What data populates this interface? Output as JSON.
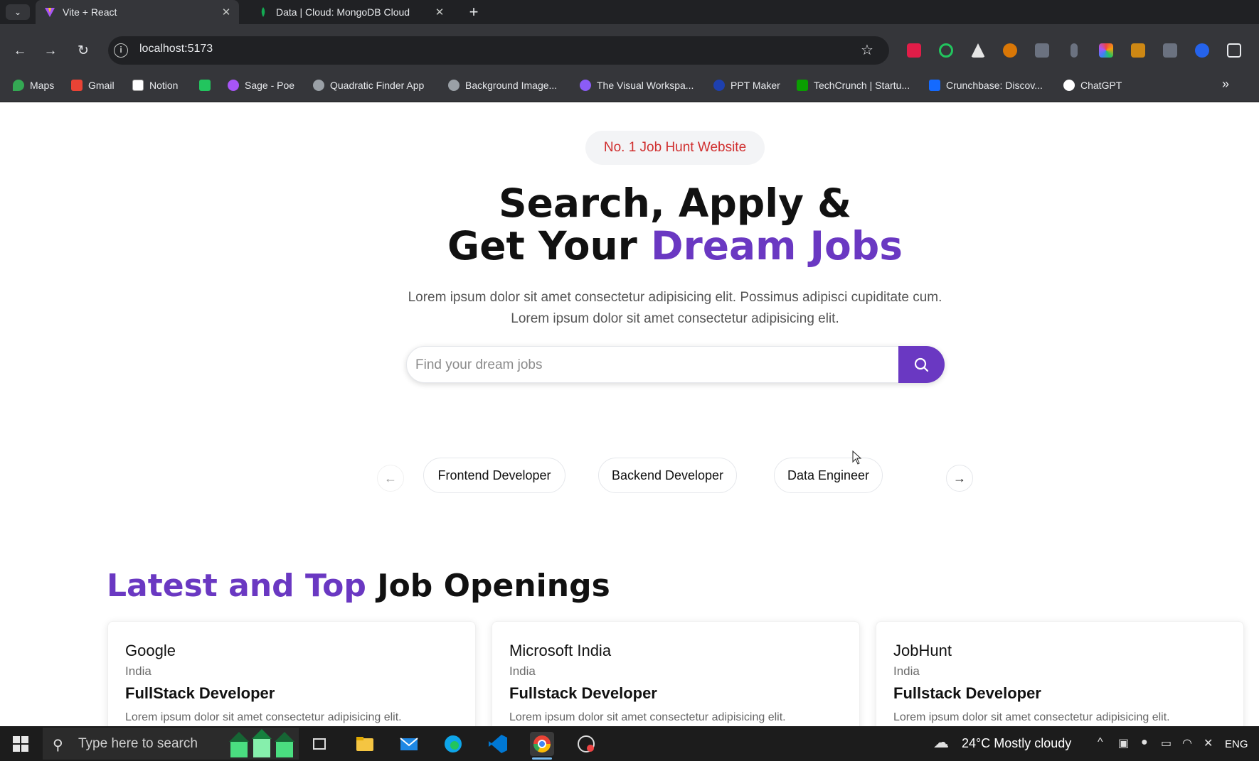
{
  "browser": {
    "tabs": [
      {
        "title": "Vite + React",
        "active": true,
        "icon": "vite-icon"
      },
      {
        "title": "Data | Cloud: MongoDB Cloud",
        "active": false,
        "icon": "mongodb-leaf-icon"
      }
    ],
    "close_glyph": "✕",
    "new_tab_glyph": "+",
    "url": "localhost:5173",
    "bookmarks": [
      {
        "label": "Maps",
        "icon": "maps-icon",
        "color": "#34a853"
      },
      {
        "label": "Gmail",
        "icon": "gmail-icon",
        "color": "#ea4335"
      },
      {
        "label": "Notion",
        "icon": "notion-icon",
        "color": "#ffffff"
      },
      {
        "label": "",
        "icon": "sheet-icon",
        "color": "#22c55e"
      },
      {
        "label": "Sage - Poe",
        "icon": "poe-icon",
        "color": "#a855f7"
      },
      {
        "label": "Quadratic Finder App",
        "icon": "globe-icon",
        "color": "#9aa0a6"
      },
      {
        "label": "Background Image...",
        "icon": "globe-icon",
        "color": "#9aa0a6"
      },
      {
        "label": "The Visual Workspa...",
        "icon": "workspace-icon",
        "color": "#8b5cf6"
      },
      {
        "label": "PPT Maker",
        "icon": "ppt-maker-icon",
        "color": "#1e40af"
      },
      {
        "label": "TechCrunch | Startu...",
        "icon": "techcrunch-icon",
        "color": "#0a9e01"
      },
      {
        "label": "Crunchbase: Discov...",
        "icon": "crunchbase-icon",
        "color": "#146aff"
      },
      {
        "label": "ChatGPT",
        "icon": "chatgpt-icon",
        "color": "#ffffff"
      }
    ]
  },
  "hero": {
    "badge": "No. 1 Job Hunt Website",
    "title_line1": "Search, Apply &",
    "title_line2_plain": "Get Your ",
    "title_line2_accent": "Dream Jobs",
    "subtitle_line1": "Lorem ipsum dolor sit amet consectetur adipisicing elit. Possimus adipisci cupiditate cum.",
    "subtitle_line2": "Lorem ipsum dolor sit amet consectetur adipisicing elit.",
    "search_placeholder": "Find your dream jobs"
  },
  "categories": {
    "prev_glyph": "←",
    "next_glyph": "→",
    "items": [
      "Frontend Developer",
      "Backend Developer",
      "Data Engineer"
    ]
  },
  "jobs_section": {
    "title_accent": "Latest and Top",
    "title_plain": " Job Openings",
    "cards": [
      {
        "company": "Google",
        "location": "India",
        "role": "FullStack Developer",
        "desc": "Lorem ipsum dolor sit amet consectetur adipisicing elit."
      },
      {
        "company": "Microsoft India",
        "location": "India",
        "role": "Fullstack Developer",
        "desc": "Lorem ipsum dolor sit amet consectetur adipisicing elit."
      },
      {
        "company": "JobHunt",
        "location": "India",
        "role": "Fullstack Developer",
        "desc": "Lorem ipsum dolor sit amet consectetur adipisicing elit."
      }
    ]
  },
  "taskbar": {
    "search_placeholder": "Type here to search",
    "weather": "24°C  Mostly cloudy",
    "language": "ENG"
  },
  "colors": {
    "accent": "#6a38c2",
    "badge_text": "#d02f2f"
  }
}
